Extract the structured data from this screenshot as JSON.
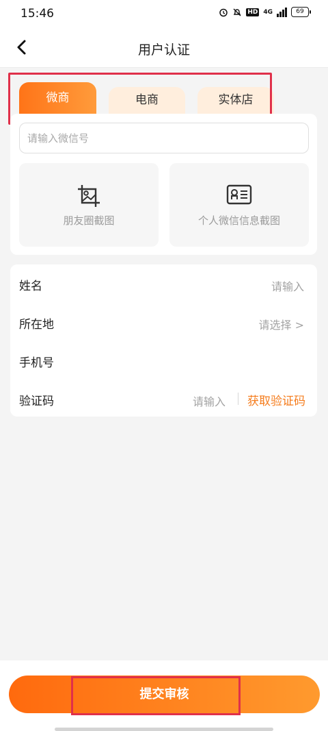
{
  "status_bar": {
    "time": "15:46",
    "network": "4G",
    "battery": "69"
  },
  "header": {
    "title": "用户认证"
  },
  "tabs": [
    {
      "label": "微商",
      "active": true
    },
    {
      "label": "电商",
      "active": false
    },
    {
      "label": "实体店",
      "active": false
    }
  ],
  "wechat_form": {
    "wechat_id_placeholder": "请输入微信号",
    "upload_moments_label": "朋友圈截图",
    "upload_profile_label": "个人微信信息截图"
  },
  "info_form": {
    "name_label": "姓名",
    "name_placeholder": "请输入",
    "location_label": "所在地",
    "location_placeholder": "请选择 >",
    "phone_label": "手机号",
    "code_label": "验证码",
    "code_placeholder": "请输入",
    "get_code_label": "获取验证码"
  },
  "footer": {
    "submit_label": "提交审核"
  },
  "colors": {
    "accent": "#ff7a1a",
    "tab_inactive_bg": "#ffeedd",
    "highlight": "#e0304a"
  }
}
